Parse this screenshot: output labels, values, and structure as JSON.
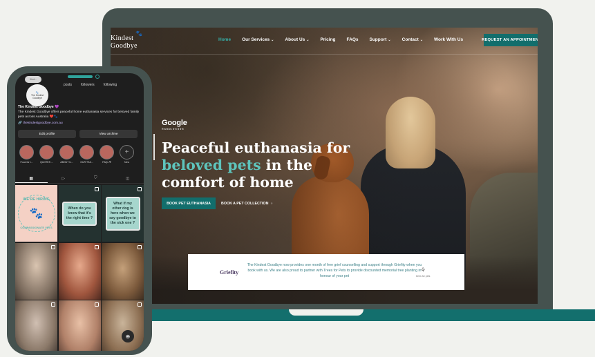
{
  "site": {
    "logo_line1": "Kindest",
    "logo_line2": "Goodbye",
    "nav": [
      {
        "label": "Home",
        "active": true,
        "has_menu": false
      },
      {
        "label": "Our Services",
        "active": false,
        "has_menu": true
      },
      {
        "label": "About Us",
        "active": false,
        "has_menu": true
      },
      {
        "label": "Pricing",
        "active": false,
        "has_menu": false
      },
      {
        "label": "FAQs",
        "active": false,
        "has_menu": false
      },
      {
        "label": "Support",
        "active": false,
        "has_menu": true
      },
      {
        "label": "Contact",
        "active": false,
        "has_menu": true
      },
      {
        "label": "Work With Us",
        "active": false,
        "has_menu": false
      }
    ],
    "cta": "REQUEST AN APPOINTMENT",
    "google_word": "Google",
    "google_sub": "Reviews ★★★★★",
    "headline_line1": "Peaceful euthanasia for",
    "headline_teal": "beloved pets",
    "headline_line2_rest": " in the",
    "headline_line3": "comfort of home",
    "btn_book": "BOOK PET EUTHANASIA",
    "btn_collection": "BOOK A PET COLLECTION",
    "griefity_logo": "Griefity",
    "griefity_text": "The Kindest Goodbye now provides one month of free grief counselling and support through Griefity when you book with us. We are also proud to partner with Trees for Pets to provide discounted memorial tree planting in honour of your pet",
    "trees_label": "trees for pets",
    "colors": {
      "accent": "#126e6c",
      "teal_text": "#5ec4bc",
      "frame": "#45524f"
    }
  },
  "instagram": {
    "pill": "Kind...",
    "avatar_text": "The Kindest Goodbye",
    "stats": [
      "posts",
      "followers",
      "following"
    ],
    "name": "The Kindest Goodbye 💜",
    "bio": "The Kindest Goodbye offers peaceful home euthanasia services for beloved family pets across Australia ❤️🐾",
    "link": "🔗 thekindestgoodbye.com.au",
    "edit_profile": "Edit profile",
    "view_archive": "View archive",
    "highlights": [
      "Food for t...",
      "QUOTES ...",
      "ABOUT U...",
      "OUR TEA...",
      "FAQs ❤",
      "New"
    ],
    "hiring_top": "WE'RE HIRING",
    "hiring_bottom": "COMPASSIONATE VETS",
    "quote1": "When do you know that it's the right time ?",
    "quote2": "What if my other dog is here when we say goodbye to the sick one ?"
  }
}
